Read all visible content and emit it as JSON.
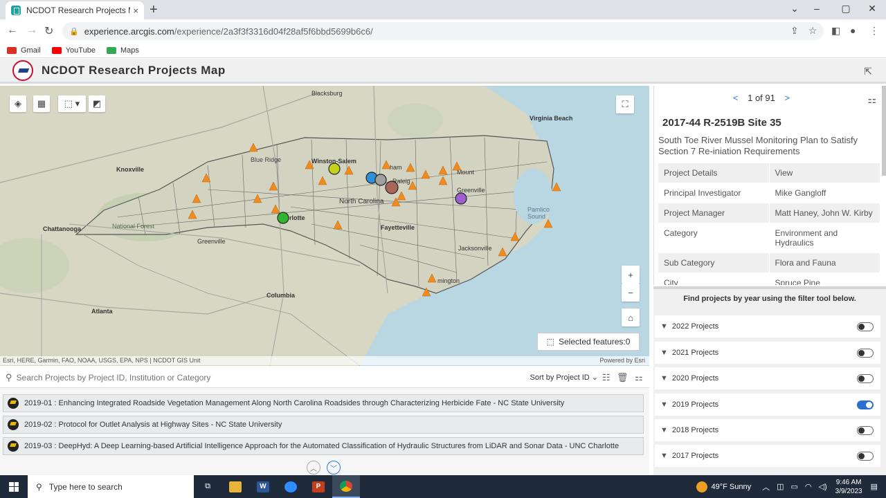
{
  "browser": {
    "tab_title": "NCDOT Research Projects Map W",
    "tab_close": "×",
    "new_tab": "+",
    "url_domain": "experience.arcgis.com",
    "url_path": "/experience/2a3f3f3316d04f28af5f6bbd5699b6c6/",
    "bookmarks": [
      {
        "label": "Gmail",
        "color": "#d93025"
      },
      {
        "label": "YouTube",
        "color": "#ff0000"
      },
      {
        "label": "Maps",
        "color": "#34a853"
      }
    ]
  },
  "app": {
    "title": "NCDOT Research Projects Map"
  },
  "map": {
    "labels": {
      "blacksburg": "Blacksburg",
      "virginia_beach": "Virginia Beach",
      "knoxville": "Knoxville",
      "winston_salem": "Winston-Salem",
      "north_carolina": "North Carolina",
      "charlotte": "rlotte",
      "fayetteville": "Fayetteville",
      "chattanooga": "Chattanooga",
      "greenville_sc": "Greenville",
      "columbia": "Columbia",
      "atlanta": "Atlanta",
      "wilmington": "mington",
      "jacksonville": "Jacksonville",
      "greenville_nc": "Greenville",
      "pamlico_sound": "Pamlico\nSound",
      "national_forest": "National Forest",
      "blue_ridge": "Blue Ridge",
      "durham": "ham",
      "raleigh": "Raleig",
      "rocky_mount": "Mount"
    },
    "selected_features": "Selected features:0",
    "attribution": "Esri, HERE, Garmin, FAO, NOAA, USGS, EPA, NPS | NCDOT GIS Unit",
    "powered_by": "Powered by Esri"
  },
  "list": {
    "search_placeholder": "Search Projects by Project ID, Institution or Category",
    "sort_label": "Sort by Project ID",
    "items": [
      "2019-01 : Enhancing Integrated Roadside Vegetation Management Along North Carolina Roadsides through Characterizing Herbicide Fate - NC State University",
      "2019-02 : Protocol for Outlet Analysis at Highway Sites - NC State University",
      "2019-03 : DeepHyd: A Deep Learning-based Artificial Intelligence Approach for the Automated Classification of Hydraulic Structures from LiDAR and Sonar Data - UNC Charlotte"
    ]
  },
  "details": {
    "pager_text": "1 of 91",
    "title": "2017-44 R-2519B Site 35",
    "subtitle": "South Toe River Mussel Monitoring Plan to Satisfy Section 7 Re-iniation Requirements",
    "rows": [
      {
        "key": "Project Details",
        "value": "View"
      },
      {
        "key": "Principal Investigator",
        "value": "Mike Gangloff"
      },
      {
        "key": "Project Manager",
        "value": "Matt Haney, John W. Kirby"
      },
      {
        "key": "Category",
        "value": "Environment and Hydraulics"
      },
      {
        "key": "Sub Category",
        "value": "Flora and Fauna"
      },
      {
        "key": "City",
        "value": "Spruce Pine"
      }
    ]
  },
  "filters": {
    "heading": "Find projects by year using the filter tool below.",
    "items": [
      {
        "label": "2022 Projects",
        "on": false
      },
      {
        "label": "2021 Projects",
        "on": false
      },
      {
        "label": "2020 Projects",
        "on": false
      },
      {
        "label": "2019 Projects",
        "on": true
      },
      {
        "label": "2018 Projects",
        "on": false
      },
      {
        "label": "2017 Projects",
        "on": false
      }
    ]
  },
  "taskbar": {
    "search_placeholder": "Type here to search",
    "weather": "49°F  Sunny",
    "time": "9:46 AM",
    "date": "3/9/2023"
  }
}
